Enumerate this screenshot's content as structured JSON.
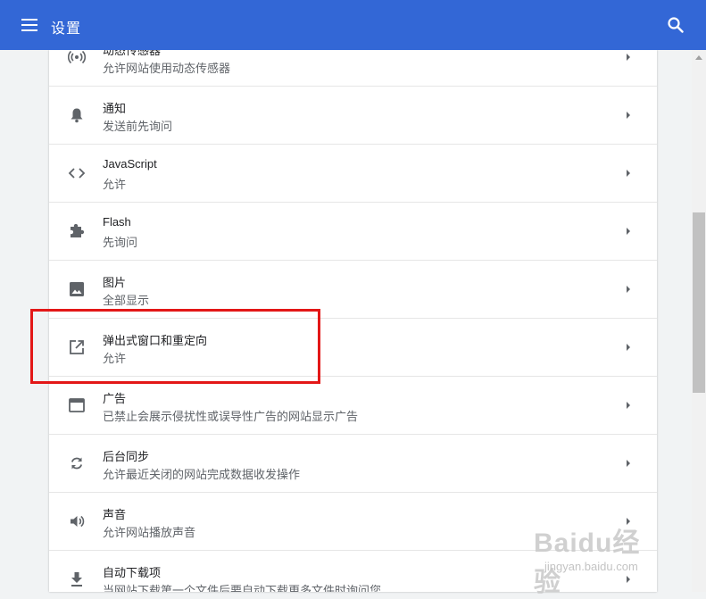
{
  "header": {
    "title": "设置",
    "menu_icon": "menu-icon",
    "search_icon": "search-icon"
  },
  "items": [
    {
      "icon": "sensors-icon",
      "label": "动态传感器",
      "sub": "允许网站使用动态传感器"
    },
    {
      "icon": "bell-icon",
      "label": "通知",
      "sub": "发送前先询问"
    },
    {
      "icon": "code-icon",
      "label": "JavaScript",
      "sub": "允许"
    },
    {
      "icon": "puzzle-icon",
      "label": "Flash",
      "sub": "先询问"
    },
    {
      "icon": "image-icon",
      "label": "图片",
      "sub": "全部显示"
    },
    {
      "icon": "open-in-new-icon",
      "label": "弹出式窗口和重定向",
      "sub": "允许"
    },
    {
      "icon": "ad-window-icon",
      "label": "广告",
      "sub": "已禁止会展示侵扰性或误导性广告的网站显示广告"
    },
    {
      "icon": "sync-icon",
      "label": "后台同步",
      "sub": "允许最近关闭的网站完成数据收发操作"
    },
    {
      "icon": "volume-icon",
      "label": "声音",
      "sub": "允许网站播放声音"
    },
    {
      "icon": "download-icon",
      "label": "自动下载项",
      "sub": "当网站下载第一个文件后要自动下载更多文件时询问您"
    }
  ],
  "watermark": {
    "main": "Baidu经验",
    "sub": "jingyan.baidu.com"
  },
  "colors": {
    "header": "#3367d6",
    "highlight": "#e31717",
    "icon": "#5f6368"
  }
}
